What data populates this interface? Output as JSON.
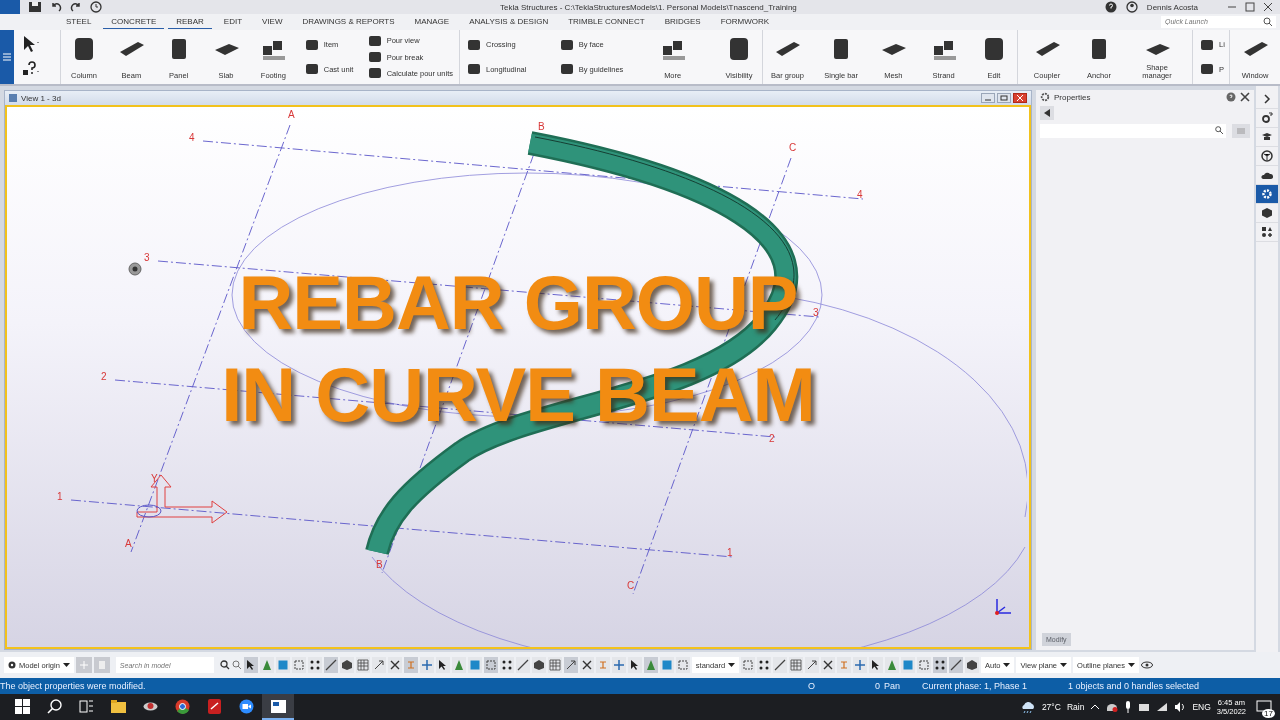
{
  "title_bar": {
    "title": "Tekla Structures - C:\\TeklaStructuresModels\\1. Personal Models\\Tnascend_Training",
    "user": "Dennis Acosta"
  },
  "menu_tabs": [
    {
      "label": "STEEL",
      "selected": false
    },
    {
      "label": "CONCRETE",
      "selected": true
    },
    {
      "label": "REBAR",
      "selected": true
    },
    {
      "label": "EDIT",
      "selected": false
    },
    {
      "label": "VIEW",
      "selected": false
    },
    {
      "label": "DRAWINGS & REPORTS",
      "selected": false
    },
    {
      "label": "MANAGE",
      "selected": false
    },
    {
      "label": "ANALYSIS & DESIGN",
      "selected": false
    },
    {
      "label": "TRIMBLE CONNECT",
      "selected": false
    },
    {
      "label": "BRIDGES",
      "selected": false
    },
    {
      "label": "FORMWORK",
      "selected": false
    }
  ],
  "quick_launch": {
    "placeholder": "Quick Launch"
  },
  "ribbon_groups": [
    {
      "columns": [
        {
          "kind": "large",
          "label": "Column"
        },
        {
          "kind": "large",
          "label": "Beam"
        },
        {
          "kind": "large",
          "label": "Panel"
        },
        {
          "kind": "large",
          "label": "Slab"
        },
        {
          "kind": "large",
          "label": "Footing"
        },
        {
          "kind": "stack",
          "items": [
            "Item",
            "Cast unit"
          ]
        },
        {
          "kind": "stack",
          "items": [
            "Pour view",
            "Pour break",
            "Calculate pour units"
          ]
        }
      ]
    },
    {
      "columns": [
        {
          "kind": "stack",
          "items": [
            "Crossing",
            "Longitudinal"
          ]
        },
        {
          "kind": "stack",
          "items": [
            "By face",
            "By guidelines"
          ]
        },
        {
          "kind": "large",
          "label": "More"
        },
        {
          "kind": "large",
          "label": "Visibility"
        }
      ]
    },
    {
      "columns": [
        {
          "kind": "large",
          "label": "Bar group"
        },
        {
          "kind": "large",
          "label": "Single bar"
        },
        {
          "kind": "large",
          "label": "Mesh"
        },
        {
          "kind": "large",
          "label": "Strand"
        },
        {
          "kind": "large",
          "label": "Edit"
        }
      ]
    },
    {
      "columns": [
        {
          "kind": "large",
          "label": "Coupler"
        },
        {
          "kind": "large",
          "label": "Anchor"
        },
        {
          "kind": "large",
          "label": "Shape manager"
        }
      ]
    },
    {
      "columns": [
        {
          "kind": "stack",
          "items": [
            "Li",
            "P"
          ]
        }
      ]
    },
    {
      "columns": [
        {
          "kind": "large",
          "label": "Window"
        }
      ]
    }
  ],
  "view": {
    "title": "View 1 - 3d",
    "grid_labels": [
      "A",
      "B",
      "C",
      "4",
      "4",
      "3",
      "3",
      "2",
      "2",
      "1",
      "1",
      "A",
      "B",
      "C"
    ],
    "axis_label": "Y",
    "overlay_lines": [
      "REBAR GROUP",
      "IN CURVE BEAM"
    ]
  },
  "properties": {
    "title": "Properties",
    "modify_button": {
      "label": "Modify",
      "disabled": true
    }
  },
  "side_tabs": [
    {
      "selected": false
    },
    {
      "selected": false
    },
    {
      "selected": false
    },
    {
      "selected": false
    },
    {
      "selected": true
    },
    {
      "selected": false
    },
    {
      "selected": false
    }
  ],
  "bottom_toolbar": {
    "origin": "Model origin",
    "search": {
      "placeholder": "Search in model"
    },
    "dropdowns": [
      "standard",
      "Auto",
      "View plane",
      "Outline planes"
    ]
  },
  "status_bar": {
    "message": "The object properties were modified.",
    "snap": "O",
    "count": "0",
    "mode": "Pan",
    "phase": "Current phase: 1, Phase 1",
    "selection": "1 objects and 0 handles selected"
  },
  "taskbar": {
    "temperature": "27°C",
    "weather": "Rain",
    "language": "ENG",
    "time": "6:45 am",
    "date": "3/5/2022",
    "notifications": "17"
  }
}
